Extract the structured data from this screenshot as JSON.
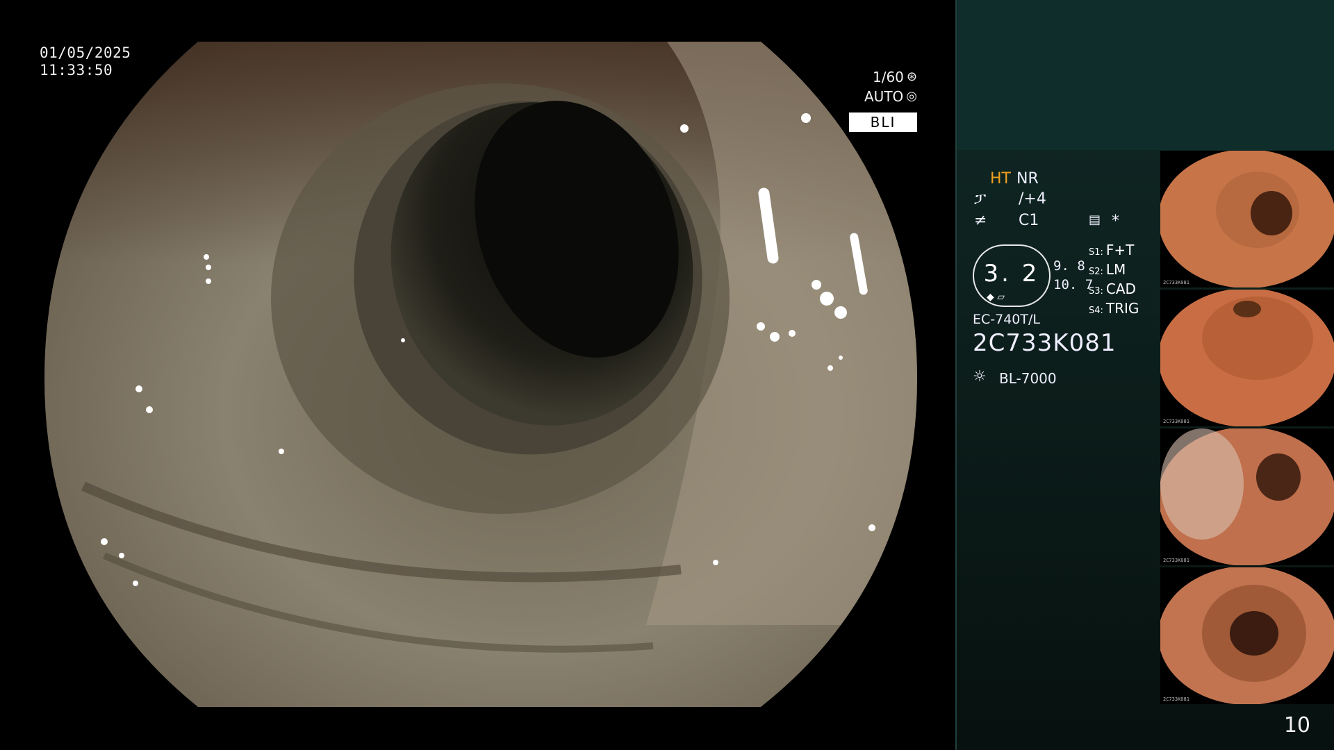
{
  "overlay": {
    "date": "01/05/2025",
    "time": "11:33:50",
    "shutter": "1/60",
    "iris": "AUTO",
    "mode": "BLI"
  },
  "panel": {
    "ht_label": "HT",
    "nr_label": "NR",
    "enhance_value": "/+4",
    "color_value": "C1",
    "asterisk": "*",
    "zoom_value": "3. 2",
    "side_value_1": "9. 8",
    "side_value_2": "10. 7",
    "switches": [
      {
        "key": "S1:",
        "value": "F+T"
      },
      {
        "key": "S2:",
        "value": "LM"
      },
      {
        "key": "S3:",
        "value": "CAD"
      },
      {
        "key": "S4:",
        "value": "TRIG"
      }
    ],
    "scope_model": "EC-740T/L",
    "scope_serial": "2C733K081",
    "light_source": "BL-7000",
    "thumb_serial": "2C733K081",
    "page_number": "10"
  },
  "colors": {
    "panel_bg": "#0f2522",
    "highlight_orange": "#f0a020",
    "mode_box_bg": "#ffffff"
  },
  "icons": [
    "aperture-icon",
    "iris-icon",
    "enhance-icon",
    "color-icon",
    "list-icon",
    "light-source-icon"
  ]
}
